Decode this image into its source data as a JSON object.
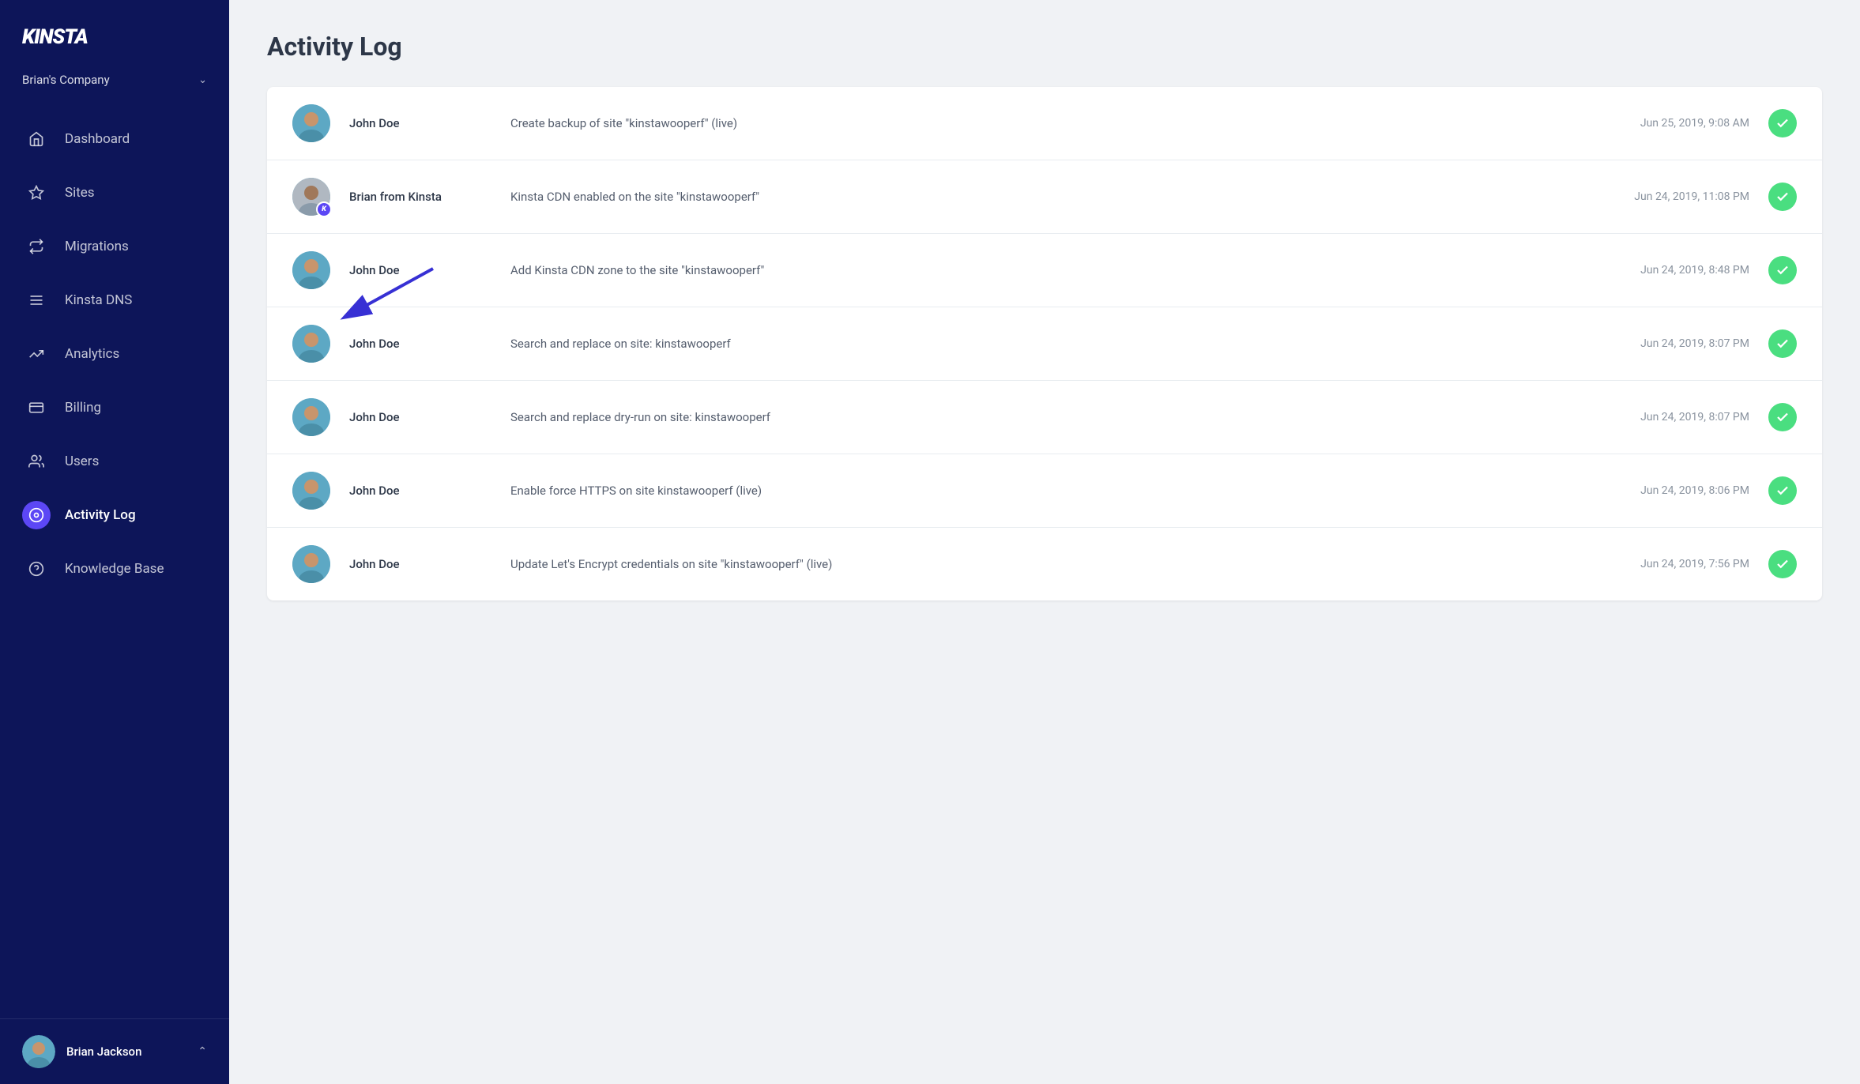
{
  "app": {
    "logo": "kinsta",
    "company": "Brian's Company"
  },
  "sidebar": {
    "nav_items": [
      {
        "id": "dashboard",
        "label": "Dashboard",
        "icon": "home-icon",
        "active": false
      },
      {
        "id": "sites",
        "label": "Sites",
        "icon": "sites-icon",
        "active": false
      },
      {
        "id": "migrations",
        "label": "Migrations",
        "icon": "migrations-icon",
        "active": false
      },
      {
        "id": "kinsta-dns",
        "label": "Kinsta DNS",
        "icon": "dns-icon",
        "active": false
      },
      {
        "id": "analytics",
        "label": "Analytics",
        "icon": "analytics-icon",
        "active": false
      },
      {
        "id": "billing",
        "label": "Billing",
        "icon": "billing-icon",
        "active": false
      },
      {
        "id": "users",
        "label": "Users",
        "icon": "users-icon",
        "active": false
      },
      {
        "id": "activity-log",
        "label": "Activity Log",
        "icon": "activity-icon",
        "active": true
      },
      {
        "id": "knowledge-base",
        "label": "Knowledge Base",
        "icon": "knowledge-icon",
        "active": false
      }
    ],
    "user": {
      "name": "Brian Jackson",
      "chevron": "^"
    }
  },
  "page": {
    "title": "Activity Log"
  },
  "activity_log": {
    "rows": [
      {
        "user": "John Doe",
        "action": "Create backup of site \"kinstawooperf\" (live)",
        "time": "Jun 25, 2019, 9:08 AM",
        "status": "success",
        "avatar_type": "john"
      },
      {
        "user": "Brian from Kinsta",
        "action": "Kinsta CDN enabled on the site \"kinstawooperf\"",
        "time": "Jun 24, 2019, 11:08 PM",
        "status": "success",
        "avatar_type": "brian_kinsta",
        "has_kinsta_badge": true
      },
      {
        "user": "John Doe",
        "action": "Add Kinsta CDN zone to the site \"kinstawooperf\"",
        "time": "Jun 24, 2019, 8:48 PM",
        "status": "success",
        "avatar_type": "john"
      },
      {
        "user": "John Doe",
        "action": "Search and replace on site: kinstawooperf",
        "time": "Jun 24, 2019, 8:07 PM",
        "status": "success",
        "avatar_type": "john"
      },
      {
        "user": "John Doe",
        "action": "Search and replace dry-run on site: kinstawooperf",
        "time": "Jun 24, 2019, 8:07 PM",
        "status": "success",
        "avatar_type": "john"
      },
      {
        "user": "John Doe",
        "action": "Enable force HTTPS on site kinstawooperf (live)",
        "time": "Jun 24, 2019, 8:06 PM",
        "status": "success",
        "avatar_type": "john"
      },
      {
        "user": "John Doe",
        "action": "Update Let's Encrypt credentials on site \"kinstawooperf\" (live)",
        "time": "Jun 24, 2019, 7:56 PM",
        "status": "success",
        "avatar_type": "john"
      }
    ]
  }
}
